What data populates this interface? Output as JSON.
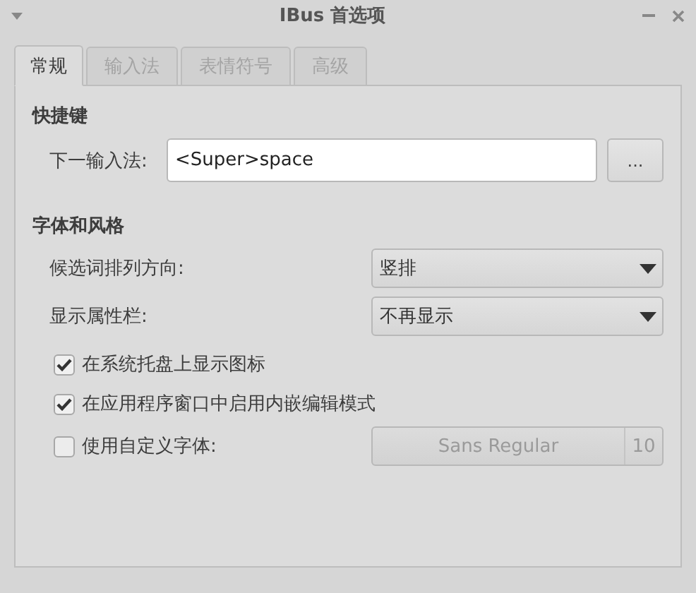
{
  "window": {
    "title": "IBus 首选项"
  },
  "tabs": [
    {
      "label": "常规",
      "selected": true
    },
    {
      "label": "输入法",
      "selected": false
    },
    {
      "label": "表情符号",
      "selected": false
    },
    {
      "label": "高级",
      "selected": false
    }
  ],
  "shortcuts": {
    "heading": "快捷键",
    "label": "下一输入法:",
    "value": "<Super>space",
    "button": "..."
  },
  "fonts_style": {
    "heading": "字体和风格",
    "dropdowns": [
      {
        "label": "候选词排列方向:",
        "value": "竖排"
      },
      {
        "label": "显示属性栏:",
        "value": "不再显示"
      }
    ],
    "options": [
      {
        "kind": "checkbox",
        "label": "在系统托盘上显示图标",
        "checked": true
      },
      {
        "kind": "checkbox",
        "label": "在应用程序窗口中启用内嵌编辑模式",
        "checked": true
      },
      {
        "kind": "font",
        "label": "使用自定义字体:",
        "checked": false,
        "font": "Sans Regular",
        "size": "10"
      }
    ]
  }
}
